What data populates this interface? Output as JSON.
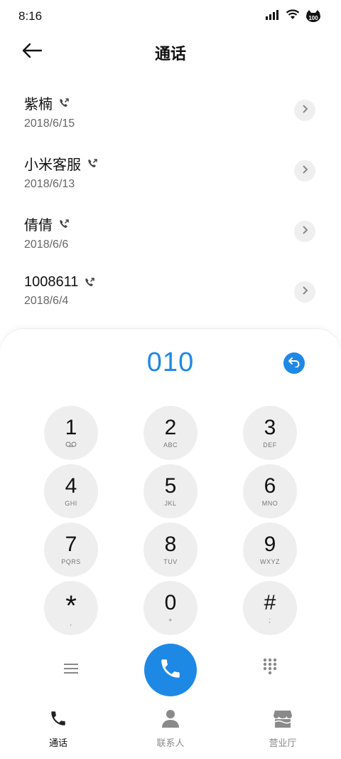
{
  "status_bar": {
    "time": "8:16",
    "battery_label": "100",
    "icons": [
      "signal-icon",
      "wifi-icon",
      "battery-icon"
    ]
  },
  "header": {
    "title": "通话",
    "back_icon": "arrow-left-icon"
  },
  "call_log": [
    {
      "name": "紫楠",
      "date": "2018/6/15"
    },
    {
      "name": "小米客服",
      "date": "2018/6/13"
    },
    {
      "name": "倩倩",
      "date": "2018/6/6"
    },
    {
      "name": "1008611",
      "date": "2018/6/4"
    }
  ],
  "dialer": {
    "number": "010",
    "keys": [
      {
        "main": "1",
        "sub": "voicemail-icon"
      },
      {
        "main": "2",
        "sub": "ABC"
      },
      {
        "main": "3",
        "sub": "DEF"
      },
      {
        "main": "4",
        "sub": "GHI"
      },
      {
        "main": "5",
        "sub": "JKL"
      },
      {
        "main": "6",
        "sub": "MNO"
      },
      {
        "main": "7",
        "sub": "PQRS"
      },
      {
        "main": "8",
        "sub": "TUV"
      },
      {
        "main": "9",
        "sub": "WXYZ"
      },
      {
        "main": "*",
        "sub": ","
      },
      {
        "main": "0",
        "sub": "+"
      },
      {
        "main": "#",
        "sub": ";"
      }
    ]
  },
  "bottom_nav": [
    {
      "label": "通话",
      "icon": "phone-icon",
      "active": true
    },
    {
      "label": "联系人",
      "icon": "person-icon",
      "active": false
    },
    {
      "label": "营业厅",
      "icon": "store-icon",
      "active": false
    }
  ],
  "colors": {
    "accent": "#1e88e5",
    "key_bg": "#eeeeee",
    "text_primary": "#111111",
    "text_secondary": "#666666"
  }
}
